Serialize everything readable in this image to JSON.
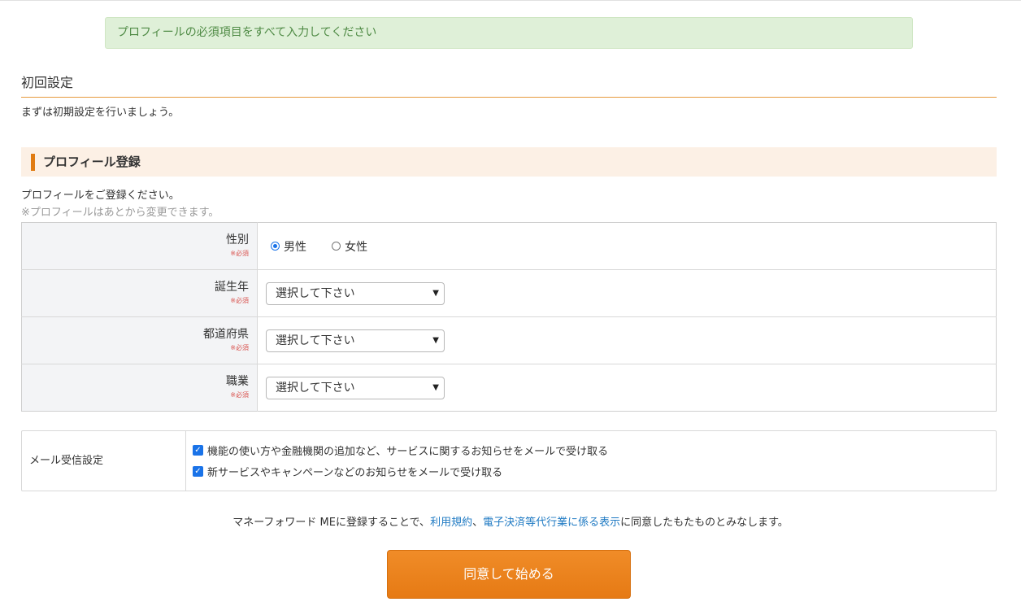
{
  "alert": {
    "text": "プロフィールの必須項目をすべて入力してください"
  },
  "page": {
    "title": "初回設定",
    "intro": "まずは初期設定を行いましょう。"
  },
  "section": {
    "title": "プロフィール登録",
    "description": "プロフィールをご登録ください。",
    "note": "※プロフィールはあとから変更できます。"
  },
  "form": {
    "required_mark": "※必須",
    "gender": {
      "label": "性別",
      "options": [
        "男性",
        "女性"
      ],
      "selected": "男性"
    },
    "birth_year": {
      "label": "誕生年",
      "value": "選択して下さい"
    },
    "prefecture": {
      "label": "都道府県",
      "value": "選択して下さい"
    },
    "occupation": {
      "label": "職業",
      "value": "選択して下さい"
    }
  },
  "mail": {
    "label": "メール受信設定",
    "options": [
      {
        "text": "機能の使い方や金融機関の追加など、サービスに関するお知らせをメールで受け取る",
        "checked": true
      },
      {
        "text": "新サービスやキャンペーンなどのお知らせをメールで受け取る",
        "checked": true
      }
    ]
  },
  "agreement": {
    "prefix": "マネーフォワード MEに登録することで、",
    "link1": "利用規約",
    "separator": "、",
    "link2": "電子決済等代行業に係る表示",
    "suffix": "に同意したもたものとみなします。"
  },
  "submit": {
    "label": "同意して始める"
  },
  "colors": {
    "accent": "#e67a14",
    "link": "#1f7ac3",
    "alert_bg": "#dff0d8",
    "check": "#1a73e8"
  }
}
